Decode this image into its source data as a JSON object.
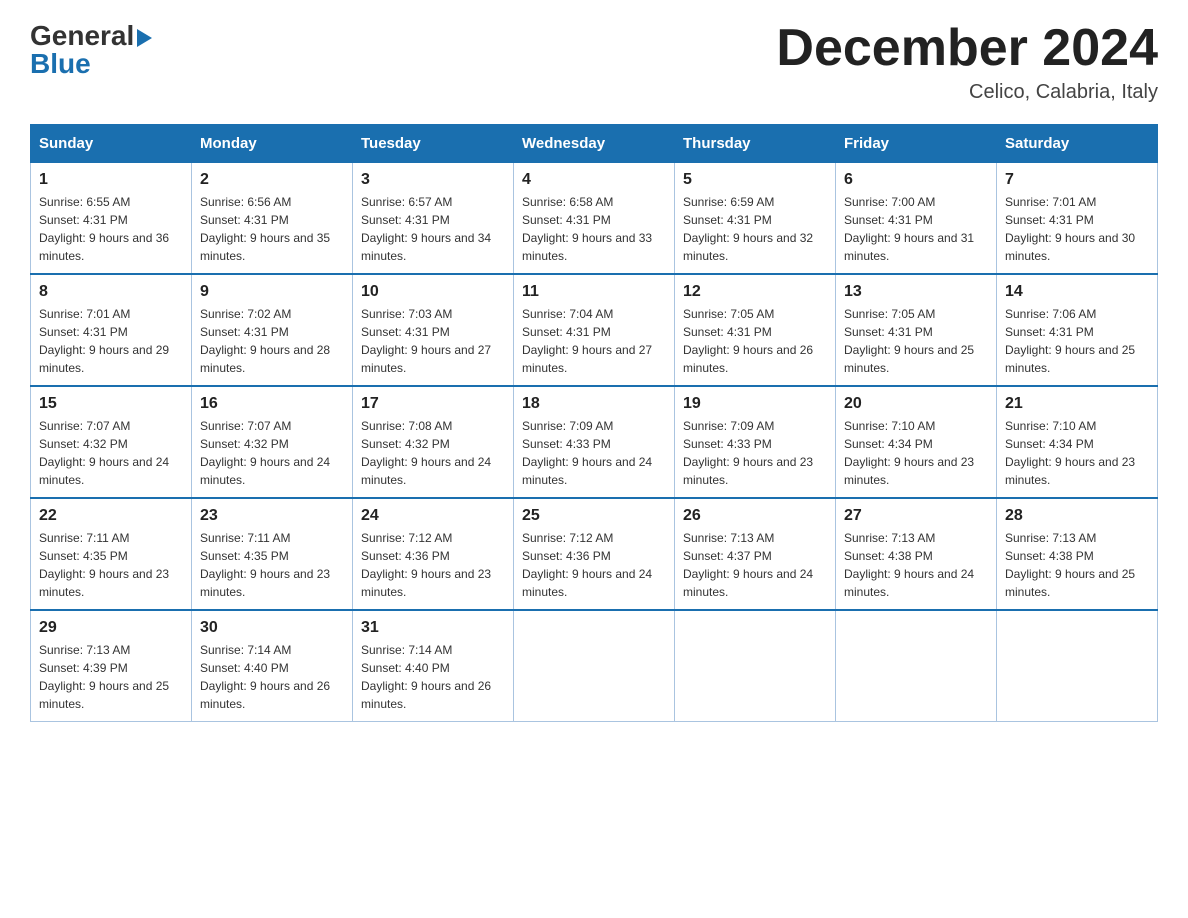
{
  "header": {
    "logo_general": "General",
    "logo_blue": "Blue",
    "month_title": "December 2024",
    "location": "Celico, Calabria, Italy"
  },
  "calendar": {
    "days_of_week": [
      "Sunday",
      "Monday",
      "Tuesday",
      "Wednesday",
      "Thursday",
      "Friday",
      "Saturday"
    ],
    "weeks": [
      [
        {
          "day": "1",
          "sunrise": "Sunrise: 6:55 AM",
          "sunset": "Sunset: 4:31 PM",
          "daylight": "Daylight: 9 hours and 36 minutes."
        },
        {
          "day": "2",
          "sunrise": "Sunrise: 6:56 AM",
          "sunset": "Sunset: 4:31 PM",
          "daylight": "Daylight: 9 hours and 35 minutes."
        },
        {
          "day": "3",
          "sunrise": "Sunrise: 6:57 AM",
          "sunset": "Sunset: 4:31 PM",
          "daylight": "Daylight: 9 hours and 34 minutes."
        },
        {
          "day": "4",
          "sunrise": "Sunrise: 6:58 AM",
          "sunset": "Sunset: 4:31 PM",
          "daylight": "Daylight: 9 hours and 33 minutes."
        },
        {
          "day": "5",
          "sunrise": "Sunrise: 6:59 AM",
          "sunset": "Sunset: 4:31 PM",
          "daylight": "Daylight: 9 hours and 32 minutes."
        },
        {
          "day": "6",
          "sunrise": "Sunrise: 7:00 AM",
          "sunset": "Sunset: 4:31 PM",
          "daylight": "Daylight: 9 hours and 31 minutes."
        },
        {
          "day": "7",
          "sunrise": "Sunrise: 7:01 AM",
          "sunset": "Sunset: 4:31 PM",
          "daylight": "Daylight: 9 hours and 30 minutes."
        }
      ],
      [
        {
          "day": "8",
          "sunrise": "Sunrise: 7:01 AM",
          "sunset": "Sunset: 4:31 PM",
          "daylight": "Daylight: 9 hours and 29 minutes."
        },
        {
          "day": "9",
          "sunrise": "Sunrise: 7:02 AM",
          "sunset": "Sunset: 4:31 PM",
          "daylight": "Daylight: 9 hours and 28 minutes."
        },
        {
          "day": "10",
          "sunrise": "Sunrise: 7:03 AM",
          "sunset": "Sunset: 4:31 PM",
          "daylight": "Daylight: 9 hours and 27 minutes."
        },
        {
          "day": "11",
          "sunrise": "Sunrise: 7:04 AM",
          "sunset": "Sunset: 4:31 PM",
          "daylight": "Daylight: 9 hours and 27 minutes."
        },
        {
          "day": "12",
          "sunrise": "Sunrise: 7:05 AM",
          "sunset": "Sunset: 4:31 PM",
          "daylight": "Daylight: 9 hours and 26 minutes."
        },
        {
          "day": "13",
          "sunrise": "Sunrise: 7:05 AM",
          "sunset": "Sunset: 4:31 PM",
          "daylight": "Daylight: 9 hours and 25 minutes."
        },
        {
          "day": "14",
          "sunrise": "Sunrise: 7:06 AM",
          "sunset": "Sunset: 4:31 PM",
          "daylight": "Daylight: 9 hours and 25 minutes."
        }
      ],
      [
        {
          "day": "15",
          "sunrise": "Sunrise: 7:07 AM",
          "sunset": "Sunset: 4:32 PM",
          "daylight": "Daylight: 9 hours and 24 minutes."
        },
        {
          "day": "16",
          "sunrise": "Sunrise: 7:07 AM",
          "sunset": "Sunset: 4:32 PM",
          "daylight": "Daylight: 9 hours and 24 minutes."
        },
        {
          "day": "17",
          "sunrise": "Sunrise: 7:08 AM",
          "sunset": "Sunset: 4:32 PM",
          "daylight": "Daylight: 9 hours and 24 minutes."
        },
        {
          "day": "18",
          "sunrise": "Sunrise: 7:09 AM",
          "sunset": "Sunset: 4:33 PM",
          "daylight": "Daylight: 9 hours and 24 minutes."
        },
        {
          "day": "19",
          "sunrise": "Sunrise: 7:09 AM",
          "sunset": "Sunset: 4:33 PM",
          "daylight": "Daylight: 9 hours and 23 minutes."
        },
        {
          "day": "20",
          "sunrise": "Sunrise: 7:10 AM",
          "sunset": "Sunset: 4:34 PM",
          "daylight": "Daylight: 9 hours and 23 minutes."
        },
        {
          "day": "21",
          "sunrise": "Sunrise: 7:10 AM",
          "sunset": "Sunset: 4:34 PM",
          "daylight": "Daylight: 9 hours and 23 minutes."
        }
      ],
      [
        {
          "day": "22",
          "sunrise": "Sunrise: 7:11 AM",
          "sunset": "Sunset: 4:35 PM",
          "daylight": "Daylight: 9 hours and 23 minutes."
        },
        {
          "day": "23",
          "sunrise": "Sunrise: 7:11 AM",
          "sunset": "Sunset: 4:35 PM",
          "daylight": "Daylight: 9 hours and 23 minutes."
        },
        {
          "day": "24",
          "sunrise": "Sunrise: 7:12 AM",
          "sunset": "Sunset: 4:36 PM",
          "daylight": "Daylight: 9 hours and 23 minutes."
        },
        {
          "day": "25",
          "sunrise": "Sunrise: 7:12 AM",
          "sunset": "Sunset: 4:36 PM",
          "daylight": "Daylight: 9 hours and 24 minutes."
        },
        {
          "day": "26",
          "sunrise": "Sunrise: 7:13 AM",
          "sunset": "Sunset: 4:37 PM",
          "daylight": "Daylight: 9 hours and 24 minutes."
        },
        {
          "day": "27",
          "sunrise": "Sunrise: 7:13 AM",
          "sunset": "Sunset: 4:38 PM",
          "daylight": "Daylight: 9 hours and 24 minutes."
        },
        {
          "day": "28",
          "sunrise": "Sunrise: 7:13 AM",
          "sunset": "Sunset: 4:38 PM",
          "daylight": "Daylight: 9 hours and 25 minutes."
        }
      ],
      [
        {
          "day": "29",
          "sunrise": "Sunrise: 7:13 AM",
          "sunset": "Sunset: 4:39 PM",
          "daylight": "Daylight: 9 hours and 25 minutes."
        },
        {
          "day": "30",
          "sunrise": "Sunrise: 7:14 AM",
          "sunset": "Sunset: 4:40 PM",
          "daylight": "Daylight: 9 hours and 26 minutes."
        },
        {
          "day": "31",
          "sunrise": "Sunrise: 7:14 AM",
          "sunset": "Sunset: 4:40 PM",
          "daylight": "Daylight: 9 hours and 26 minutes."
        },
        null,
        null,
        null,
        null
      ]
    ]
  }
}
